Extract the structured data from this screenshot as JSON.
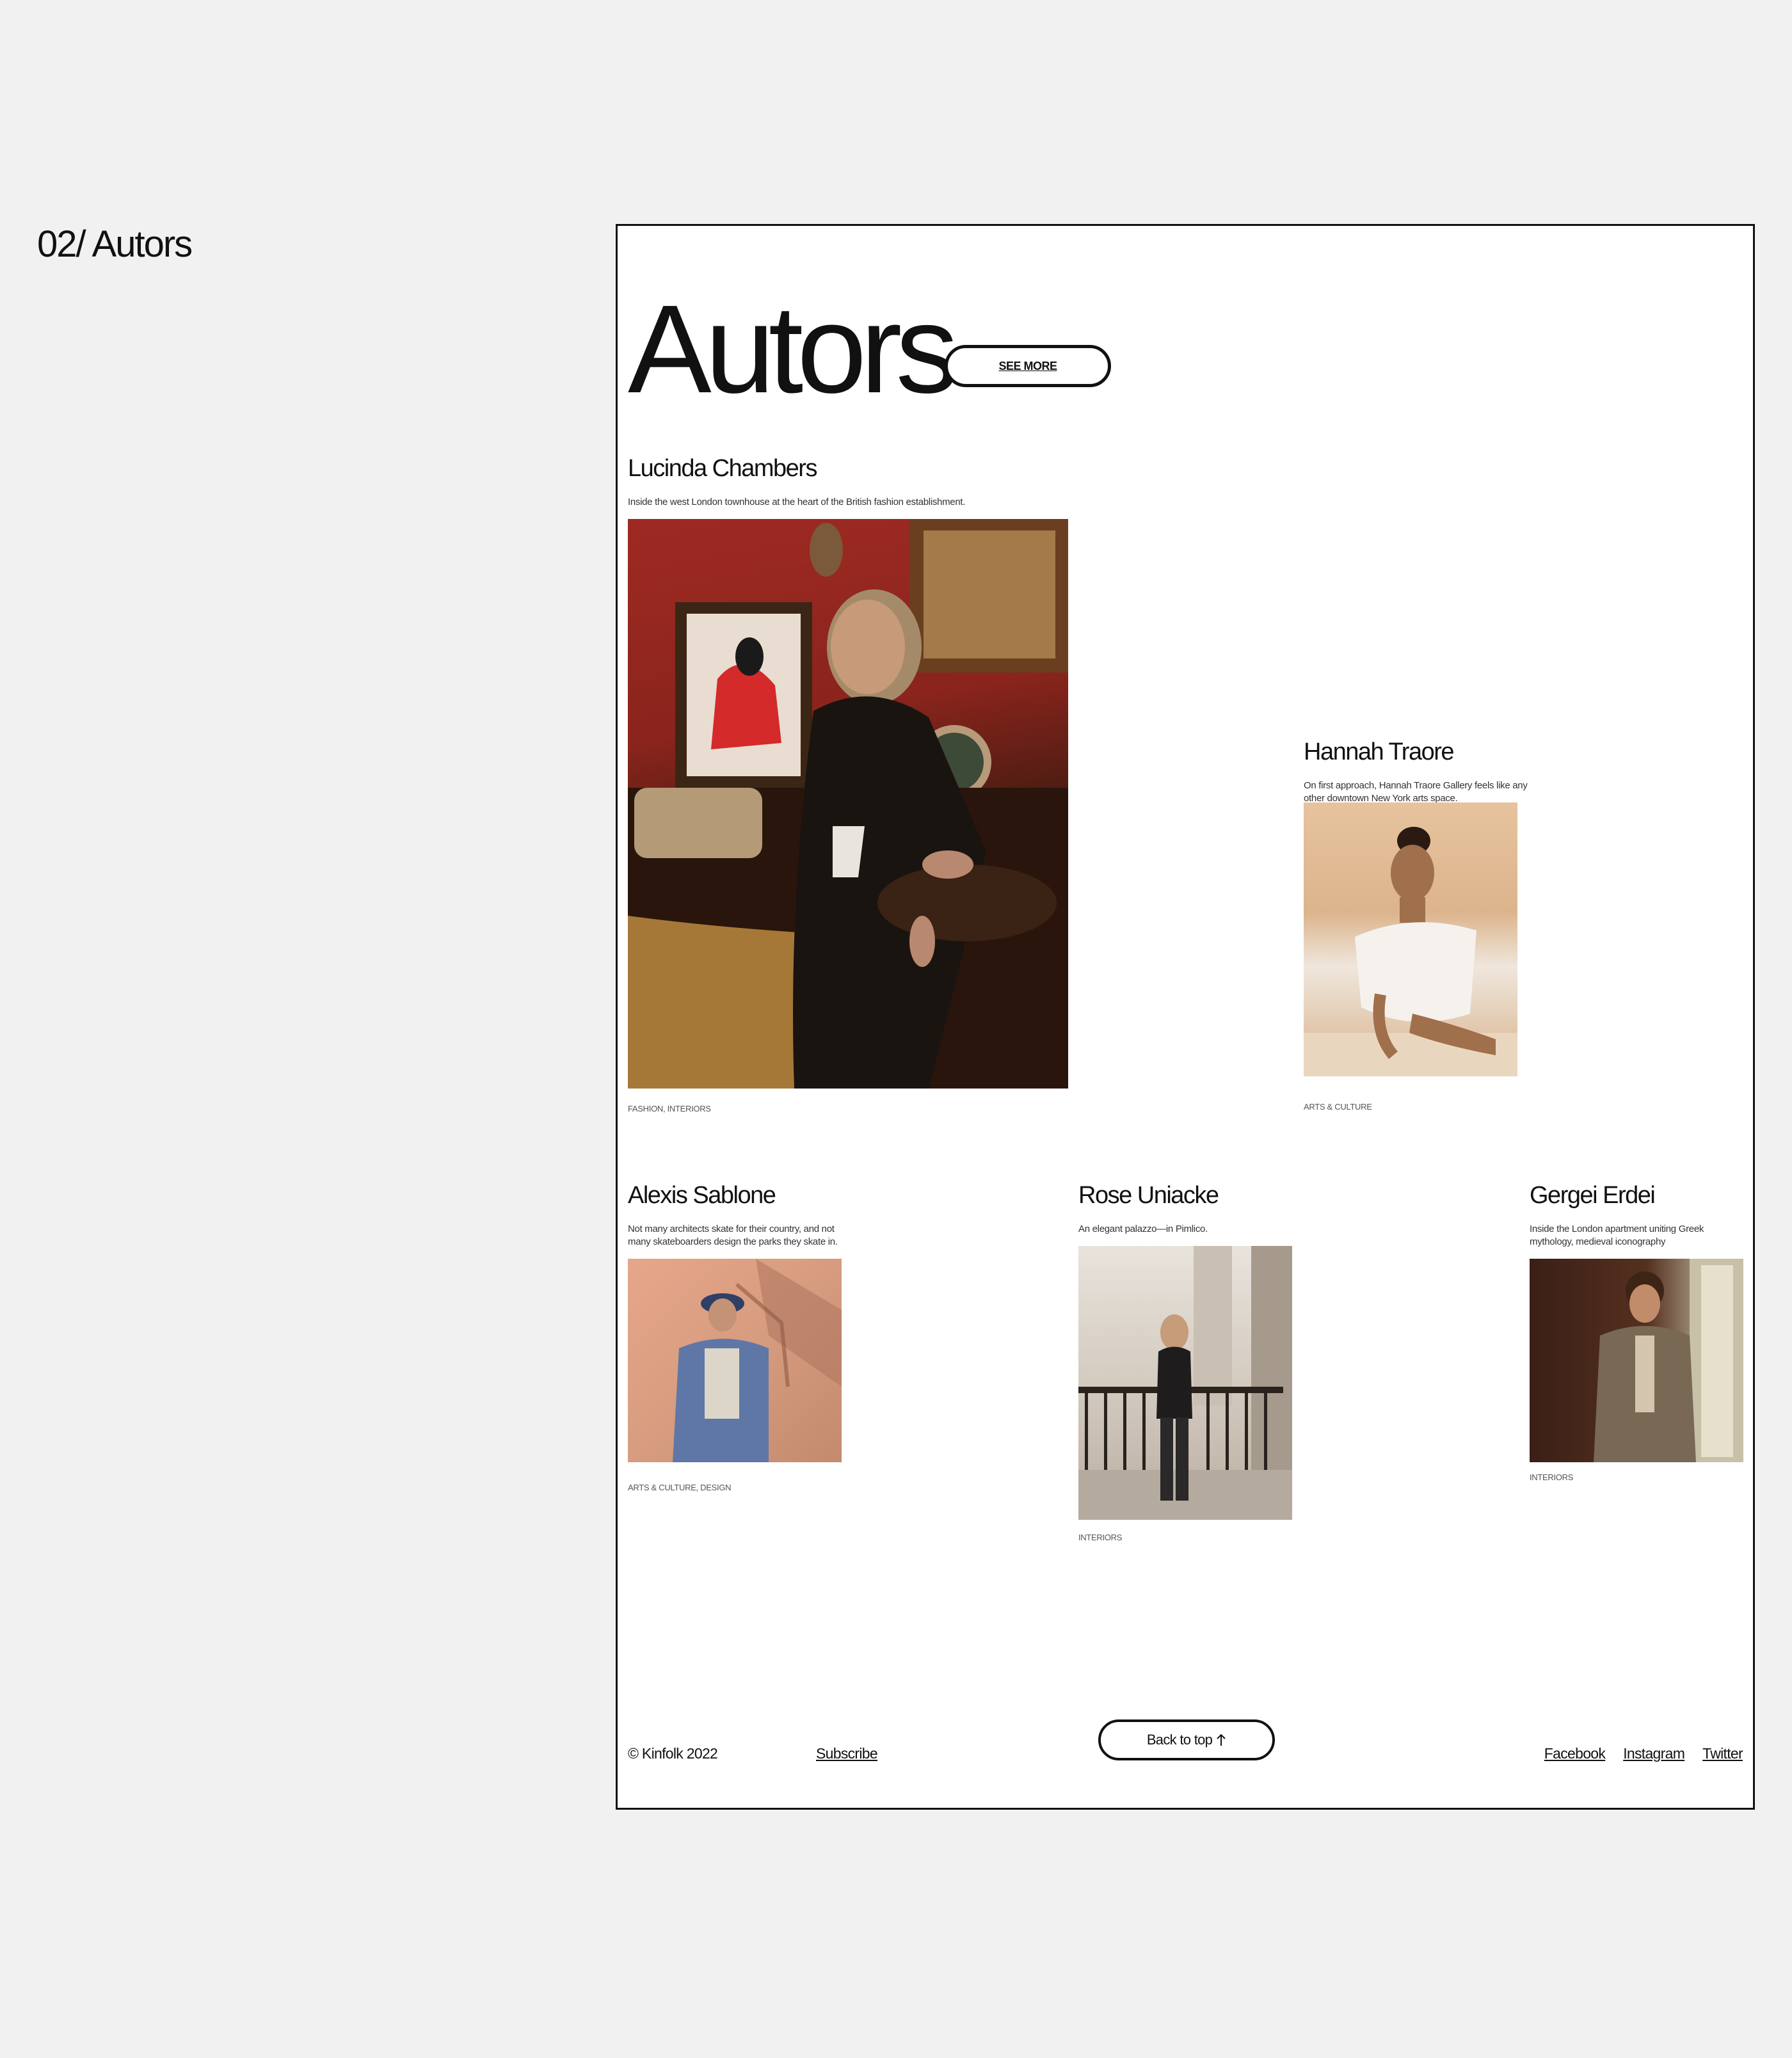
{
  "section": {
    "label": "02/ Autors"
  },
  "hero": {
    "title": "Autors",
    "see_more": "SEE MORE"
  },
  "authors": [
    {
      "name": "Lucinda Chambers",
      "description": "Inside the west London townhouse at the heart of the British fashion establishment.",
      "tags": "FASHION, INTERIORS"
    },
    {
      "name": "Hannah Traore",
      "description": "On first approach, Hannah Traore Gallery feels like any other downtown New York arts space.",
      "tags": "ARTS & CULTURE"
    },
    {
      "name": "Alexis Sablone",
      "description": "Not many architects skate for their country, and not many skateboarders design the parks they skate in.",
      "tags": "ARTS & CULTURE, DESIGN"
    },
    {
      "name": "Rose Uniacke",
      "description": "An elegant palazzo—in Pimlico.",
      "tags": "INTERIORS"
    },
    {
      "name": "Gergei Erdei",
      "description": "Inside the London apartment uniting Greek mythology, medieval iconography",
      "tags": "INTERIORS"
    }
  ],
  "footer": {
    "copyright": "© Kinfolk 2022",
    "subscribe": "Subscribe",
    "back_to_top": "Back to top",
    "socials": [
      "Facebook",
      "Instagram",
      "Twitter"
    ]
  }
}
